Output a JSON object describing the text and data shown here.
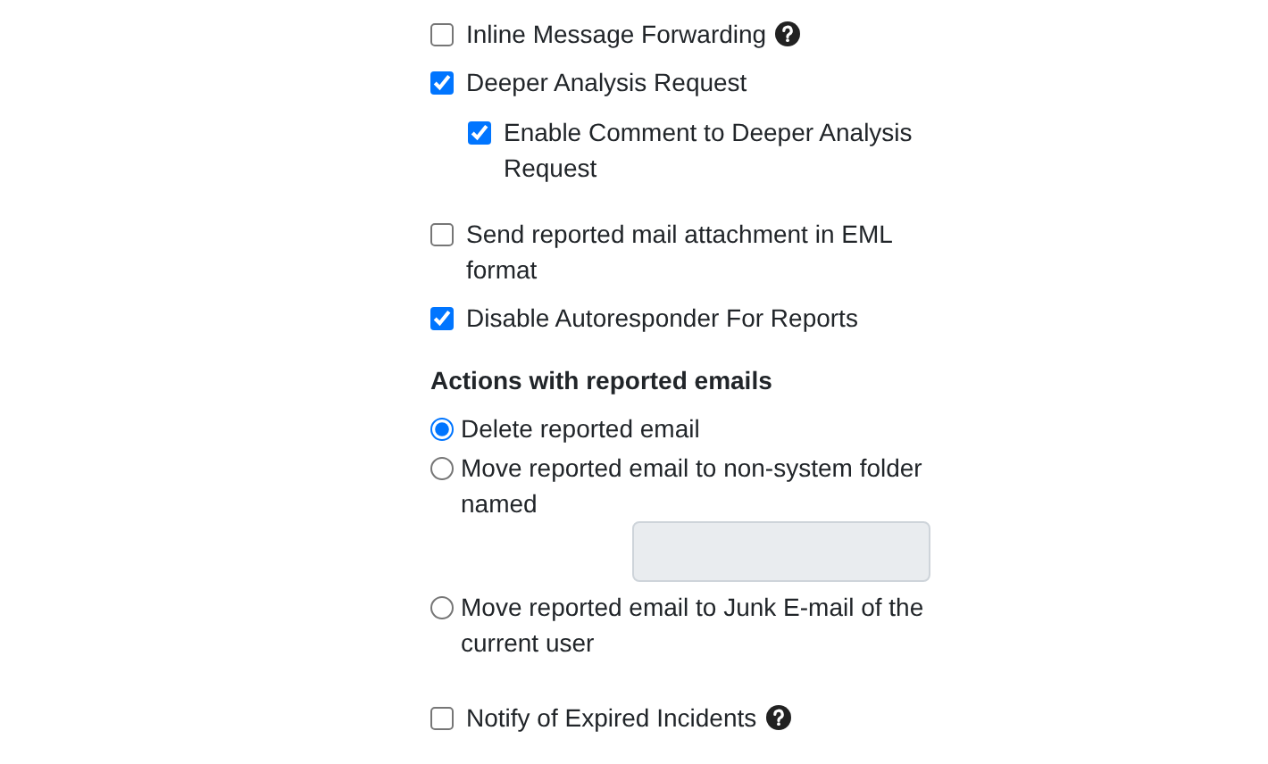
{
  "options": [
    {
      "label": "Inline Message Forwarding",
      "checked": false,
      "help": true
    },
    {
      "label": "Deeper Analysis Request",
      "checked": true,
      "children": [
        {
          "label": "Enable Comment to Deeper Analysis Request",
          "checked": true
        }
      ]
    },
    {
      "label": "Send reported mail attachment in EML format",
      "checked": false
    },
    {
      "label": "Disable Autoresponder For Reports",
      "checked": true
    }
  ],
  "actions": {
    "title": "Actions with reported emails",
    "choices": [
      {
        "label": "Delete reported email",
        "selected": true
      },
      {
        "label": "Move reported email to non-system folder named",
        "selected": false,
        "field": {
          "disabled": true
        }
      },
      {
        "label": "Move reported email to Junk E-mail of the current user",
        "selected": false
      }
    ]
  },
  "notify": {
    "label": "Notify of Expired Incidents",
    "checked": false,
    "help": true
  }
}
